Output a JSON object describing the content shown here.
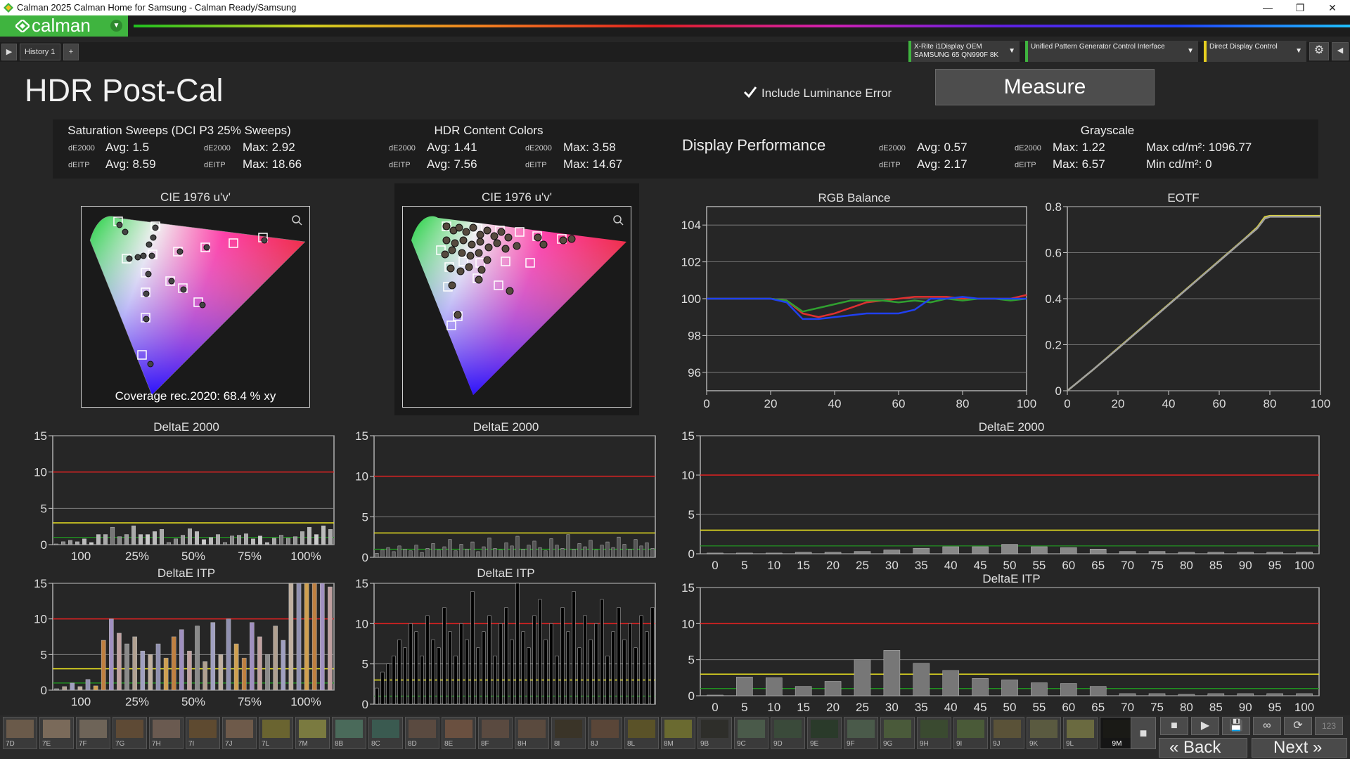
{
  "window": {
    "title": "Calman 2025 Calman Home for Samsung  - Calman Ready/Samsung",
    "min": "—",
    "max": "❐",
    "close": "✕"
  },
  "logo": "calman",
  "tabs": {
    "history": "History 1",
    "add": "+"
  },
  "devices": [
    {
      "line1": "X-Rite i1Display OEM",
      "line2": "SAMSUNG 65 QN990F 8K"
    },
    {
      "line1": "Unified Pattern Generator Control Interface",
      "line2": ""
    },
    {
      "line1": "Direct Display Control",
      "line2": ""
    }
  ],
  "page": {
    "title": "HDR Post-Cal",
    "lum_label": "Include Luminance Error",
    "measure": "Measure"
  },
  "summary": {
    "sat": {
      "title": "Saturation Sweeps (DCI P3 25% Sweeps)",
      "de2000": "dE2000",
      "deitp": "dEITP",
      "avg_label": "Avg:",
      "max_label": "Max:",
      "de_avg": "1.5",
      "de_max": "2.92",
      "itp_avg": "8.59",
      "itp_max": "18.66"
    },
    "hdr": {
      "title": "HDR Content Colors",
      "de_avg": "1.41",
      "de_max": "3.58",
      "itp_avg": "7.56",
      "itp_max": "14.67"
    },
    "perf": "Display Performance",
    "gray": {
      "title": "Grayscale",
      "de_avg": "0.57",
      "de_max": "1.22",
      "itp_avg": "2.17",
      "itp_max": "6.57",
      "maxcd_label": "Max cd/m²:",
      "maxcd": "1096.77",
      "mincd_label": "Min cd/m²:",
      "mincd": "0"
    }
  },
  "cie1": {
    "title": "CIE 1976 u'v'",
    "coverage": "Coverage rec.2020:  68.4 % xy"
  },
  "cie2": {
    "title": "CIE 1976 u'v'"
  },
  "chart_data": [
    {
      "id": "rgb",
      "type": "line",
      "title": "RGB Balance",
      "xlim": [
        0,
        100
      ],
      "ylim": [
        95,
        105
      ],
      "xticks": [
        0,
        20,
        40,
        60,
        80,
        100
      ],
      "yticks": [
        96,
        98,
        100,
        102,
        104
      ],
      "x": [
        0,
        5,
        10,
        15,
        20,
        25,
        30,
        35,
        40,
        45,
        50,
        55,
        60,
        65,
        70,
        75,
        80,
        85,
        90,
        95,
        100
      ],
      "series": [
        {
          "color": "#e03030",
          "values": [
            100,
            100,
            100,
            100,
            100,
            99.9,
            99.2,
            99.0,
            99.2,
            99.5,
            99.8,
            99.9,
            100,
            100.1,
            100.1,
            100.1,
            100,
            100,
            100,
            100,
            100.2
          ]
        },
        {
          "color": "#30a030",
          "values": [
            100,
            100,
            100,
            100,
            100,
            99.9,
            99.3,
            99.5,
            99.7,
            99.9,
            99.9,
            99.9,
            99.8,
            99.9,
            99.8,
            100,
            99.9,
            100,
            100,
            99.9,
            100
          ]
        },
        {
          "color": "#2040f0",
          "values": [
            100,
            100,
            100,
            100,
            100,
            99.8,
            98.9,
            98.9,
            99.0,
            99.1,
            99.2,
            99.2,
            99.2,
            99.4,
            100,
            100,
            100.1,
            100,
            100,
            100,
            100
          ]
        }
      ]
    },
    {
      "id": "eotf",
      "type": "line",
      "title": "EOTF",
      "xlim": [
        0,
        100
      ],
      "ylim": [
        0,
        0.8
      ],
      "xticks": [
        0,
        20,
        40,
        60,
        80,
        100
      ],
      "yticks": [
        0,
        0.2,
        0.4,
        0.6,
        0.8
      ],
      "ytickfmt": [
        "0",
        "0.2",
        "0.4",
        "0.6",
        "0.8"
      ],
      "x": [
        0,
        10,
        20,
        30,
        40,
        50,
        60,
        70,
        75,
        78,
        80,
        90,
        100
      ],
      "series": [
        {
          "color": "#d8d040",
          "values": [
            0,
            0.09,
            0.185,
            0.28,
            0.375,
            0.47,
            0.565,
            0.66,
            0.71,
            0.755,
            0.76,
            0.76,
            0.76
          ]
        },
        {
          "color": "#a0a0a0",
          "values": [
            0,
            0.09,
            0.183,
            0.278,
            0.373,
            0.468,
            0.563,
            0.658,
            0.705,
            0.748,
            0.756,
            0.756,
            0.756
          ]
        }
      ]
    },
    {
      "id": "de1",
      "type": "bar",
      "title": "DeltaE 2000",
      "ylim": [
        0,
        15
      ],
      "yticks": [
        0,
        5,
        10,
        15
      ],
      "xticklabels": [
        "100",
        "25%",
        "50%",
        "75%",
        "100%"
      ],
      "values": [
        0.1,
        0.4,
        0.6,
        0.4,
        0.8,
        0.3,
        1.4,
        1.4,
        2.4,
        1.1,
        1.4,
        2.6,
        1.4,
        1.4,
        1.8,
        2.1,
        0.3,
        0.8,
        1.3,
        2.2,
        1.8,
        0.7,
        1.0,
        1.4,
        0.3,
        1.2,
        1.3,
        1.5,
        0.8,
        1.2,
        0.3,
        0.9,
        1.3,
        0.9,
        1.1,
        1.8,
        2.4,
        1.4,
        2.6,
        2.1
      ],
      "colors": [
        "#777",
        "#888",
        "#999",
        "#aaa",
        "#bbb",
        "#ccc",
        "#bbb",
        "#aaa"
      ]
    },
    {
      "id": "de2",
      "type": "bar",
      "title": "DeltaE 2000",
      "ylim": [
        0,
        15
      ],
      "yticks": [
        0,
        5,
        10,
        15
      ],
      "xticklabels": [],
      "values": [
        0.5,
        0.9,
        1.2,
        0.7,
        1.4,
        1.0,
        0.8,
        1.5,
        0.6,
        1.1,
        1.7,
        0.9,
        1.3,
        2.2,
        0.8,
        1.6,
        1.0,
        1.9,
        0.7,
        1.3,
        2.4,
        1.1,
        0.9,
        1.8,
        1.4,
        2.6,
        1.0,
        1.5,
        2.0,
        1.2,
        0.8,
        2.3,
        1.5,
        1.1,
        2.8,
        1.0,
        1.7,
        1.3,
        2.1,
        0.9,
        1.5,
        1.9,
        1.2,
        2.5,
        1.6,
        1.0,
        2.2,
        1.4,
        1.8,
        1.1
      ],
      "colors": [
        "#555"
      ]
    },
    {
      "id": "de3",
      "type": "bar",
      "title": "DeltaE 2000",
      "ylim": [
        0,
        15
      ],
      "yticks": [
        0,
        5,
        10,
        15
      ],
      "xticklabels": [
        "0",
        "5",
        "10",
        "15",
        "20",
        "25",
        "30",
        "35",
        "40",
        "45",
        "50",
        "55",
        "60",
        "65",
        "70",
        "75",
        "80",
        "85",
        "90",
        "95",
        "100"
      ],
      "values": [
        0.1,
        0.1,
        0.1,
        0.2,
        0.2,
        0.3,
        0.5,
        0.7,
        0.9,
        0.9,
        1.2,
        0.9,
        0.8,
        0.6,
        0.3,
        0.3,
        0.2,
        0.2,
        0.2,
        0.2,
        0.2
      ],
      "colors": [
        "#888"
      ]
    },
    {
      "id": "itp1",
      "type": "bar",
      "title": "DeltaE ITP",
      "ylim": [
        0,
        15
      ],
      "yticks": [
        0,
        5,
        10,
        15
      ],
      "xticklabels": [
        "100",
        "25%",
        "50%",
        "75%",
        "100%"
      ],
      "values": [
        0.2,
        0.5,
        1.0,
        0.5,
        1.5,
        0.6,
        7.0,
        10.0,
        8.0,
        6.5,
        7.5,
        5.5,
        5.0,
        6.5,
        4.5,
        7.5,
        8.5,
        5.5,
        9.0,
        4.0,
        9.5,
        5.0,
        10.0,
        6.5,
        4.5,
        9.5,
        7.5,
        5.0,
        9.0,
        7.0,
        15,
        15,
        15,
        15,
        15,
        14.5
      ],
      "colors": [
        "#8a8a8a",
        "#b0a090",
        "#a0a0c0",
        "#c0b0a0",
        "#9090b0",
        "#d0a050",
        "#c08040",
        "#a090c0",
        "#c0a0a0"
      ]
    },
    {
      "id": "itp2",
      "type": "bar",
      "title": "DeltaE ITP",
      "ylim": [
        0,
        15
      ],
      "yticks": [
        0,
        5,
        10,
        15
      ],
      "xticklabels": [],
      "values": [
        2,
        4,
        5,
        6,
        8,
        7,
        10,
        9,
        6,
        11,
        8,
        7,
        12,
        9,
        6,
        10,
        8,
        14,
        7,
        9,
        11,
        6,
        10,
        12,
        8,
        15,
        9,
        7,
        11,
        13,
        8,
        10,
        6,
        12,
        9,
        14,
        7,
        11,
        8,
        10,
        13,
        6,
        9,
        12,
        8,
        10,
        7,
        11,
        9,
        12
      ],
      "colors": [
        "#000"
      ]
    },
    {
      "id": "itp3",
      "type": "bar",
      "title": "DeltaE ITP",
      "ylim": [
        0,
        15
      ],
      "yticks": [
        0,
        5,
        10,
        15
      ],
      "xticklabels": [
        "0",
        "5",
        "10",
        "15",
        "20",
        "25",
        "30",
        "35",
        "40",
        "45",
        "50",
        "55",
        "60",
        "65",
        "70",
        "75",
        "80",
        "85",
        "90",
        "95",
        "100"
      ],
      "values": [
        0.1,
        2.6,
        2.5,
        1.3,
        2.0,
        5.0,
        6.3,
        4.5,
        3.5,
        2.4,
        2.2,
        1.8,
        1.7,
        1.3,
        0.3,
        0.3,
        0.2,
        0.3,
        0.3,
        0.3,
        0.3
      ],
      "colors": [
        "#777"
      ]
    }
  ],
  "swatches": [
    {
      "l": "7D",
      "c": "#6a5a4a"
    },
    {
      "l": "7E",
      "c": "#7a6a5a"
    },
    {
      "l": "7F",
      "c": "#6e6458"
    },
    {
      "l": "7G",
      "c": "#5e4a35"
    },
    {
      "l": "7H",
      "c": "#6a5a50"
    },
    {
      "l": "7I",
      "c": "#5e4a30"
    },
    {
      "l": "7J",
      "c": "#6e5a4a"
    },
    {
      "l": "7L",
      "c": "#6a6430"
    },
    {
      "l": "7M",
      "c": "#7a7a40"
    },
    {
      "l": "8B",
      "c": "#4a6a5a"
    },
    {
      "l": "8C",
      "c": "#3a5a50"
    },
    {
      "l": "8D",
      "c": "#5a4a40"
    },
    {
      "l": "8E",
      "c": "#6a5040"
    },
    {
      "l": "8F",
      "c": "#5a4a40"
    },
    {
      "l": "8H",
      "c": "#5a4a3e"
    },
    {
      "l": "8I",
      "c": "#3a3428"
    },
    {
      "l": "8J",
      "c": "#5a4638"
    },
    {
      "l": "8L",
      "c": "#5a5228"
    },
    {
      "l": "8M",
      "c": "#6a6a30"
    },
    {
      "l": "9B",
      "c": "#2e2e2a"
    },
    {
      "l": "9C",
      "c": "#4a5a4a"
    },
    {
      "l": "9D",
      "c": "#3a4a3a"
    },
    {
      "l": "9E",
      "c": "#2a3a2a"
    },
    {
      "l": "9F",
      "c": "#4a5a4a"
    },
    {
      "l": "9G",
      "c": "#4a5a3a"
    },
    {
      "l": "9H",
      "c": "#3a4a30"
    },
    {
      "l": "9I",
      "c": "#4a5a38"
    },
    {
      "l": "9J",
      "c": "#5a5238"
    },
    {
      "l": "9K",
      "c": "#5a5a40"
    },
    {
      "l": "9L",
      "c": "#6a6a40"
    },
    {
      "l": "9M",
      "c": "#1a1a16"
    }
  ],
  "controls": {
    "stop": "■",
    "play": "▶",
    "save": "💾",
    "loop": "∞",
    "refresh": "⟳",
    "num": "123",
    "back": "Back",
    "next": "Next"
  }
}
